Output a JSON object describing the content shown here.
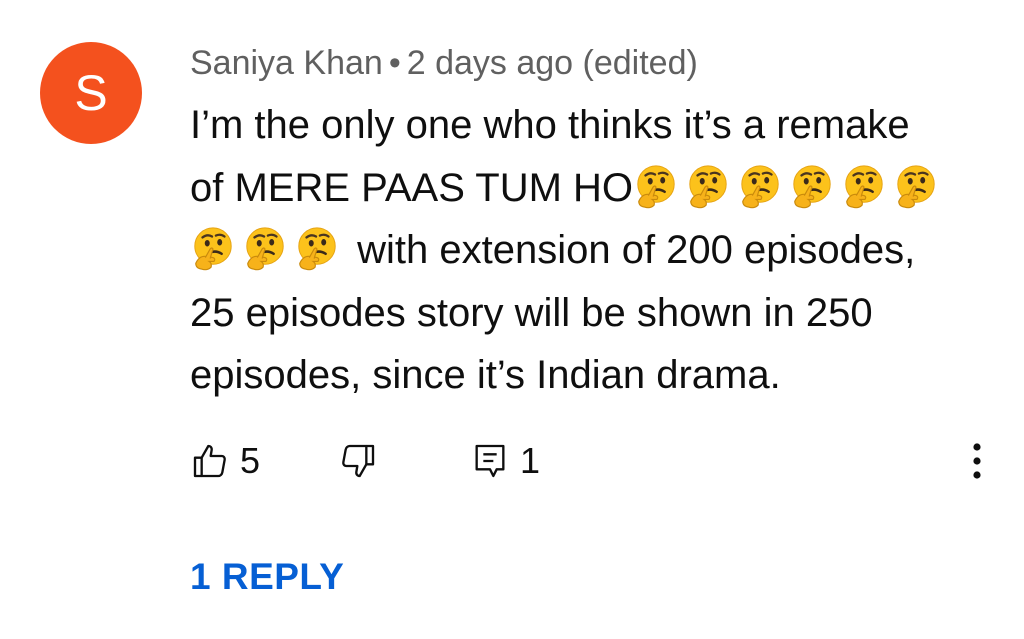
{
  "comment": {
    "avatar_letter": "S",
    "avatar_color": "#f4511e",
    "author": "Saniya Khan",
    "separator": "•",
    "timestamp": "2 days ago (edited)",
    "text_lines": [
      "I’m the only one who thinks it’s a remake",
      "of MERE PAAS TUM HO",
      " with extension of 200 episodes,",
      "25 episodes story will be shown in 250",
      "episodes, since it’s Indian drama."
    ],
    "emoji": "thinking-face",
    "emoji_count_line2": 6,
    "emoji_count_line3": 3,
    "likes": "5",
    "replies_count": "1",
    "reply_link": "1 REPLY",
    "link_color": "#065fd4"
  }
}
